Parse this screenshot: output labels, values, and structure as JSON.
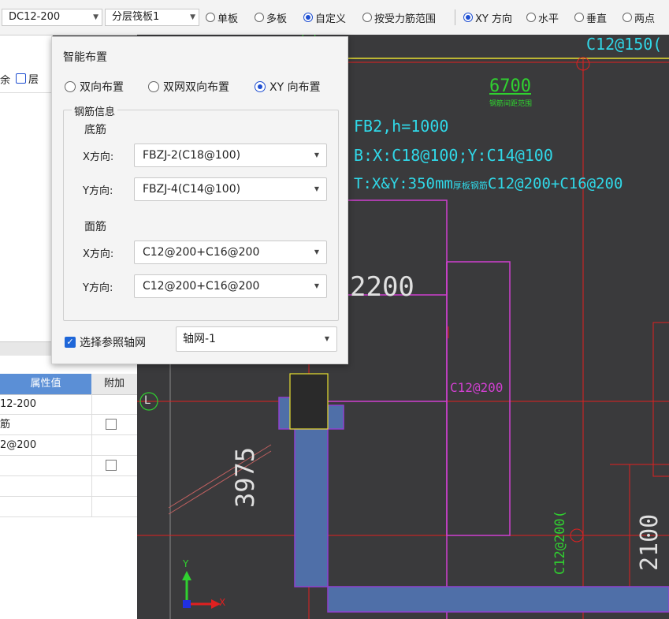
{
  "toolbar": {
    "component_combo": "DC12-200",
    "layer_combo": "分层筏板1",
    "radios": [
      {
        "label": "单板",
        "checked": false
      },
      {
        "label": "多板",
        "checked": false
      },
      {
        "label": "自定义",
        "checked": true
      },
      {
        "label": "按受力筋范围",
        "checked": false
      },
      {
        "label": "XY 方向",
        "checked": true
      },
      {
        "label": "水平",
        "checked": false
      },
      {
        "label": "垂直",
        "checked": false
      },
      {
        "label": "两点",
        "checked": false
      }
    ]
  },
  "left_panel": {
    "tool_partial_1": "余",
    "tool_partial_2": "层",
    "table_headers": [
      "属性值",
      "附加"
    ],
    "rows": [
      {
        "value": "12-200",
        "has_checkbox": false
      },
      {
        "value": "筋",
        "has_checkbox": true
      },
      {
        "value": "2@200",
        "has_checkbox": false
      },
      {
        "value": "",
        "has_checkbox": true
      },
      {
        "value": "",
        "has_checkbox": false
      },
      {
        "value": "",
        "has_checkbox": false
      }
    ]
  },
  "dialog": {
    "title": "智能布置",
    "modes": [
      {
        "label": "双向布置",
        "checked": false
      },
      {
        "label": "双网双向布置",
        "checked": false
      },
      {
        "label": "XY 向布置",
        "checked": true
      }
    ],
    "group_title": "钢筋信息",
    "bottom_title": "底筋",
    "top_title": "面筋",
    "bottom_x_label": "X方向:",
    "bottom_x_value": "FBZJ-2(C18@100)",
    "bottom_y_label": "Y方向:",
    "bottom_y_value": "FBZJ-4(C14@100)",
    "top_x_label": "X方向:",
    "top_x_value": "C12@200+C16@200",
    "top_y_label": "Y方向:",
    "top_y_value": "C12@200+C16@200",
    "axis_checkbox_label": "选择参照轴网",
    "axis_checked": true,
    "axis_value": "轴网-1"
  },
  "canvas": {
    "label_top": "C12@150(",
    "label_6700": "6700",
    "label_6700_sub": "钢筋间距范围",
    "slab_name": "FB2,h=1000",
    "slab_bottom": "B:X:C18@100;Y:C14@100",
    "slab_top_prefix": "T:X&Y:350mm",
    "slab_top_mid": "厚板钢筋",
    "slab_top_suffix": "C12@200+C16@200",
    "label_2200": "2200",
    "label_c12_200": "C12@200",
    "label_3975": "3975",
    "label_2100": "2100",
    "label_vertical_green": "C12@200(",
    "axis_bubble": "L",
    "axis_y": "Y",
    "axis_x": "X",
    "colors": {
      "background": "#3a3a3c",
      "axis_red": "#e02020",
      "magenta": "#d040d0",
      "green": "#30d030",
      "cyan": "#30d8e8",
      "blue_band": "#4f6fa8"
    }
  }
}
